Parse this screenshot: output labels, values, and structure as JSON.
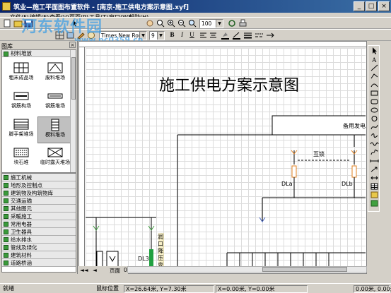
{
  "window": {
    "title": "筑业—施工平面图布置软件 - [南京-施工供电方案示意图.xyf]",
    "buttons": [
      "_",
      "□",
      "×"
    ]
  },
  "menu": [
    "文件(F)",
    "编辑(E)",
    "查看(V)",
    "页面(P)",
    "工具(T)",
    "窗口(W)",
    "帮助(H)"
  ],
  "toolbar": {
    "zoom": "100",
    "font_name": "Times New Roman",
    "font_size": "9",
    "bold": "B",
    "italic": "I",
    "underline": "U"
  },
  "watermark": {
    "text": "河东软件园",
    "url": "www.pc0359.cn"
  },
  "library": {
    "title": "图库",
    "open_category": "材料堆放",
    "items": [
      {
        "label": "粗末成品场",
        "icon": "box-grid-icon"
      },
      {
        "label": "废料堆场",
        "icon": "waste-pile-icon"
      },
      {
        "label": "钢筋构场",
        "icon": "rebar-icon"
      },
      {
        "label": "钢筋堆场",
        "icon": "rebar-stack-icon"
      },
      {
        "label": "脚手架堆场",
        "icon": "scaffold-icon"
      },
      {
        "label": "模料堆场",
        "icon": "formwork-icon",
        "selected": true
      },
      {
        "label": "块石堆",
        "icon": "stone-icon"
      },
      {
        "label": "临时露天堆场",
        "icon": "open-yard-icon"
      }
    ],
    "categories": [
      "施工机械",
      "地形及控制点",
      "建筑物及构筑物库",
      "交通运输",
      "其他图元",
      "采暖施工",
      "常用电器",
      "卫生器具",
      "给水排水",
      "管线及绿化",
      "建筑材料",
      "道路桥涵"
    ]
  },
  "drawing": {
    "title": "施工供电方案示意图",
    "labels": {
      "backup": "备用发电",
      "interlock": "互锁",
      "dla": "DLa",
      "dlb": "DLb",
      "dl3": "DL3",
      "vertical": "润口降压变"
    },
    "page_tab": "页面",
    "page_num": "0"
  },
  "status": {
    "ready": "就绪",
    "mouse_label": "鼠标位置",
    "mouse_value": "X=26.64米, Y=7.30米",
    "coord1": "X=0.00米, Y=0.00米",
    "coord2": "0.00米, 0.00米"
  }
}
